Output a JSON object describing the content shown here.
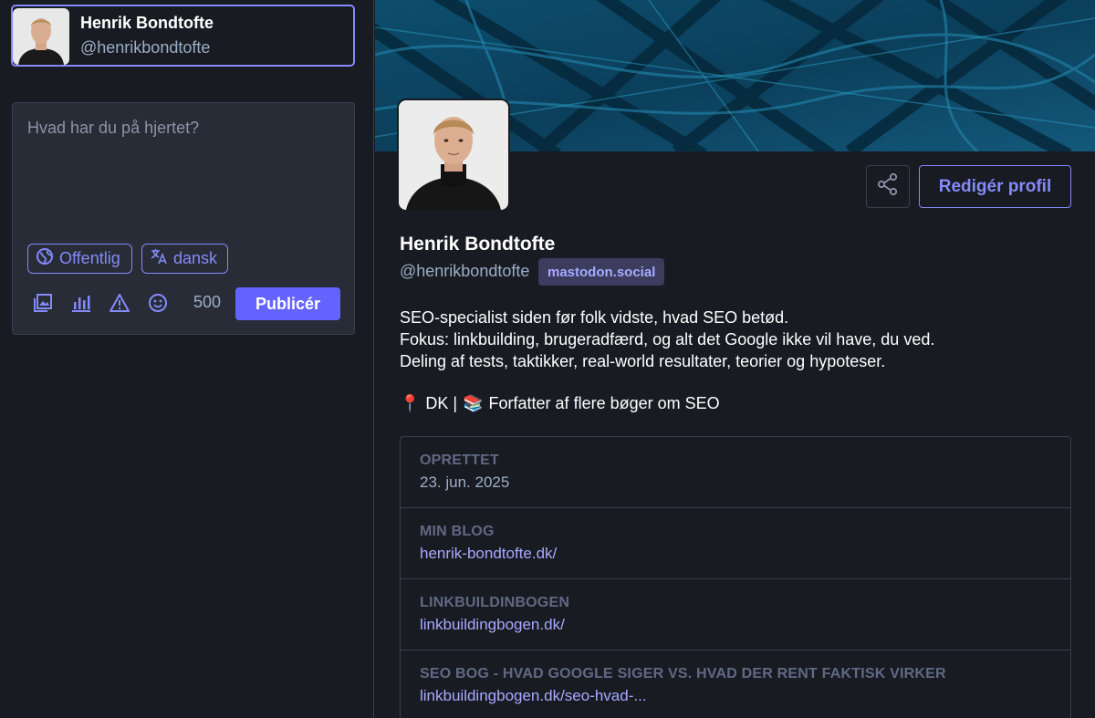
{
  "account": {
    "name": "Henrik Bondtofte",
    "handle": "@henrikbondtofte"
  },
  "composer": {
    "placeholder": "Hvad har du på hjertet?",
    "visibility_label": "Offentlig",
    "language_label": "dansk",
    "char_count": "500",
    "publish_label": "Publicér",
    "tools": [
      "media-icon",
      "poll-icon",
      "content-warning-icon",
      "emoji-icon"
    ]
  },
  "profile": {
    "name": "Henrik Bondtofte",
    "handle": "@henrikbondtofte",
    "server": "mastodon.social",
    "edit_label": "Redigér profil",
    "bio_lines": [
      "SEO-specialist siden før folk vidste, hvad SEO betød.",
      "Fokus: linkbuilding, brugeradfærd, og alt det Google ikke vil have, du ved.",
      "Deling af tests, taktikker, real-world resultater, teorier og hypoteser."
    ],
    "bio_location": {
      "pin": "📍",
      "text_1": "DK |",
      "books": "📚",
      "text_2": "Forfatter af flere bøger om SEO"
    },
    "fields": [
      {
        "label": "OPRETTET",
        "value": "23. jun. 2025",
        "is_link": false
      },
      {
        "label": "MIN BLOG",
        "value": "henrik-bondtofte.dk/",
        "is_link": true
      },
      {
        "label": "LINKBUILDINBOGEN",
        "value": "linkbuildingbogen.dk/",
        "is_link": true
      },
      {
        "label": "SEO BOG - HVAD GOOGLE SIGER VS. HVAD DER RENT FAKTISK VIRKER",
        "value": "linkbuildingbogen.dk/seo-hvad-...",
        "is_link": true
      }
    ]
  },
  "colors": {
    "accent": "#858afa",
    "button": "#6364ff",
    "background": "#191b22",
    "panel": "#282c37"
  }
}
